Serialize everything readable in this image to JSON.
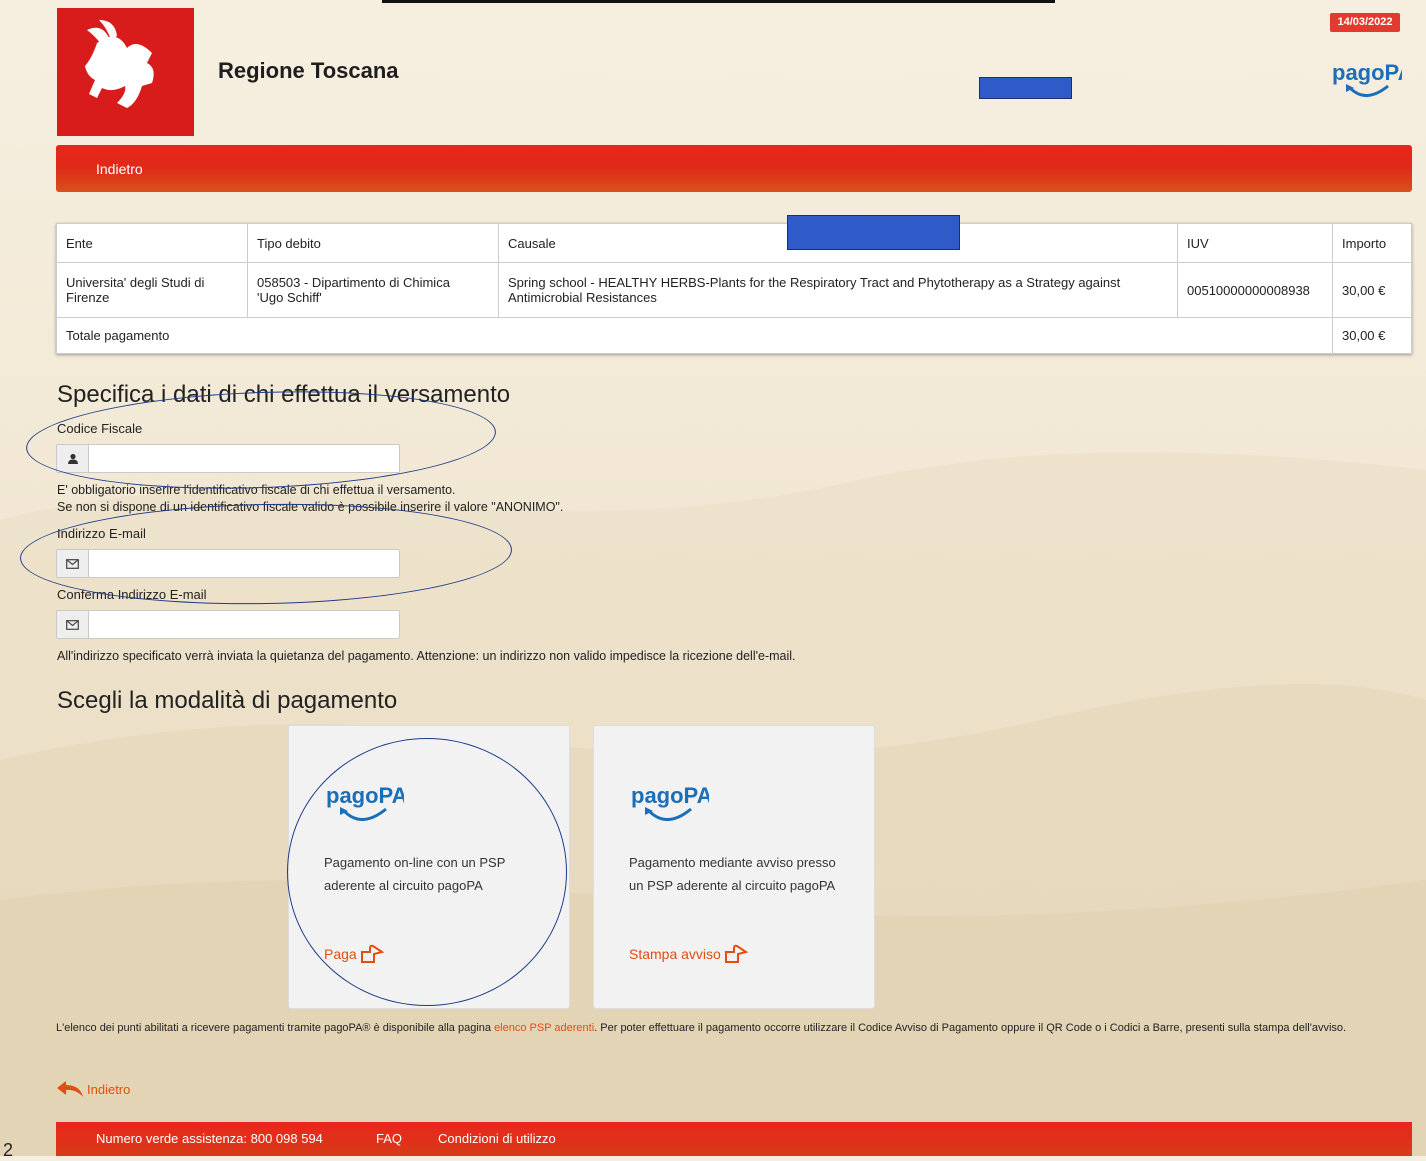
{
  "header": {
    "brand": "Regione Toscana",
    "date": "14/03/2022",
    "logo_icon": "pegasus-icon",
    "pagopa_logo": "pagoPA"
  },
  "topbar": {
    "back_label": "Indietro"
  },
  "table": {
    "headers": [
      "Ente",
      "Tipo debito",
      "Causale",
      "IUV",
      "Importo"
    ],
    "rows": [
      {
        "ente_line1": "Universita' degli Studi di",
        "ente_line2": "Firenze",
        "tipo_line1": "058503 - Dipartimento di Chimica",
        "tipo_line2": "'Ugo Schiff'",
        "causale_line1": "Spring school - HEALTHY HERBS-Plants for the Respiratory Tract and Phytotherapy as a Strategy against",
        "causale_line2": "Antimicrobial Resistances",
        "iuv": "00510000000008938",
        "importo": "30,00 €"
      }
    ],
    "total_label": "Totale pagamento",
    "total_value": "30,00 €"
  },
  "payer": {
    "title": "Specifica i dati di chi effettua il versamento",
    "cf_label": "Codice Fiscale",
    "cf_value": "",
    "cf_note_1": "E' obbligatorio inserire l'identificativo fiscale di chi effettua il versamento.",
    "cf_note_2": "Se non si dispone di un identificativo fiscale valido è possibile inserire il valore \"ANONIMO\".",
    "email_label": "Indirizzo E-mail",
    "email_value": "",
    "email_confirm_label": "Conferma Indirizzo E-mail",
    "email_confirm_value": "",
    "email_note": "All'indirizzo specificato verrà inviata la quietanza del pagamento. Attenzione: un indirizzo non valido impedisce la ricezione dell'e-mail."
  },
  "payment": {
    "title": "Scegli la modalità di pagamento",
    "cards": [
      {
        "logo": "pagoPA",
        "text": "Pagamento on-line con un PSP aderente al circuito pagoPA",
        "action": "Paga"
      },
      {
        "logo": "pagoPA",
        "text": "Pagamento mediante avviso presso un PSP aderente al circuito pagoPA",
        "action": "Stampa avviso"
      }
    ]
  },
  "psp_note": {
    "before": "L'elenco dei punti abilitati a ricevere pagamenti tramite pagoPA® è disponibile alla pagina ",
    "link": "elenco PSP aderenti",
    "after": ". Per poter effettuare il pagamento occorre utilizzare il Codice Avviso di Pagamento oppure il QR Code o i Codici a Barre, presenti sulla stampa dell'avviso."
  },
  "back_link": "Indietro",
  "footer": {
    "phone": "Numero verde assistenza: 800 098 594",
    "faq": "FAQ",
    "terms": "Condizioni di utilizzo"
  },
  "edge_number": "2",
  "colors": {
    "accent_red": "#e23a2e",
    "link_orange": "#e14e12",
    "pagopa_blue": "#1b6fb8",
    "annotation_blue": "#1f3c8a",
    "redaction_blue": "#2f5bc8"
  }
}
